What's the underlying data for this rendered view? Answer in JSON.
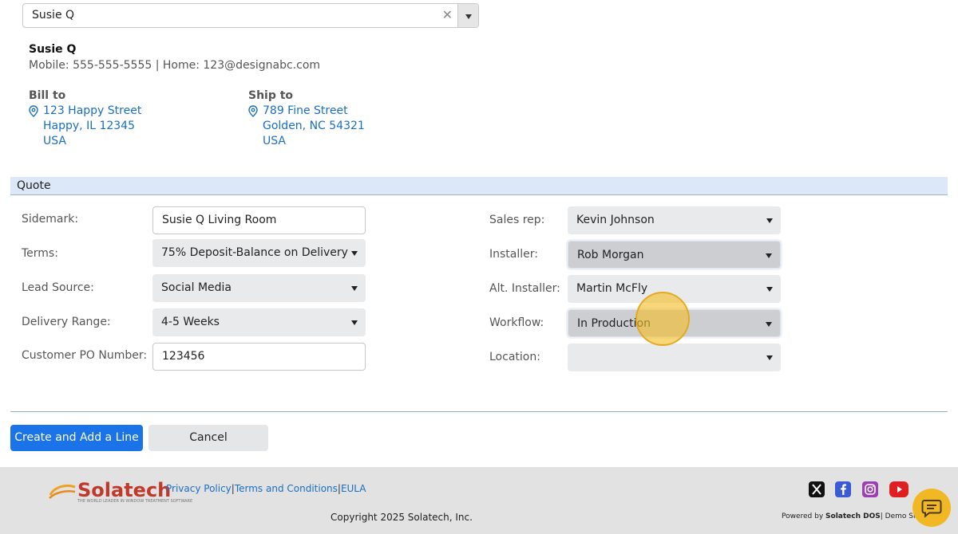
{
  "customer": {
    "selected": "Susie Q",
    "name": "Susie Q",
    "contact": "Mobile: 555-555-5555 | Home: 123@designabc.com",
    "bill_to": {
      "title": "Bill to",
      "line1": "123 Happy Street",
      "line2": "Happy, IL 12345",
      "line3": "USA"
    },
    "ship_to": {
      "title": "Ship to",
      "line1": "789 Fine Street",
      "line2": "Golden, NC 54321",
      "line3": "USA"
    }
  },
  "quote": {
    "section_title": "Quote",
    "left_fields": {
      "sidemark": {
        "label": "Sidemark:",
        "value": "Susie Q Living Room"
      },
      "terms": {
        "label": "Terms:",
        "value": "75% Deposit-Balance on Delivery"
      },
      "lead_source": {
        "label": "Lead Source:",
        "value": "Social Media"
      },
      "delivery_range": {
        "label": "Delivery Range:",
        "value": "4-5 Weeks"
      },
      "customer_po": {
        "label": "Customer PO Number:",
        "value": "123456"
      }
    },
    "right_fields": {
      "sales_rep": {
        "label": "Sales rep:",
        "value": "Kevin Johnson"
      },
      "installer": {
        "label": "Installer:",
        "value": "Rob Morgan"
      },
      "alt_installer": {
        "label": "Alt. Installer:",
        "value": "Martin McFly"
      },
      "workflow": {
        "label": "Workflow:",
        "value": "In Production"
      },
      "location": {
        "label": "Location:",
        "value": ""
      }
    }
  },
  "actions": {
    "create_label": "Create and Add a Line",
    "cancel_label": "Cancel"
  },
  "footer": {
    "logo_text": "Solatech",
    "logo_tagline": "THE WORLD LEADER IN WINDOW TREATMENT SOFTWARE",
    "privacy": "Privacy Policy",
    "terms": "Terms and Conditions",
    "eula": "EULA",
    "copyright": "Copyright 2025 Solatech, Inc.",
    "powered_prefix": "Powered by ",
    "powered_brand": "Solatech DOS",
    "powered_suffix": "| Demo Site",
    "social_icons": [
      "x-icon",
      "facebook-icon",
      "instagram-icon",
      "youtube-icon"
    ]
  },
  "colors": {
    "primary": "#1a73e8",
    "link": "#1a6ec2",
    "quote_header_bg": "#dce8f7",
    "chat": "#f2b824"
  }
}
